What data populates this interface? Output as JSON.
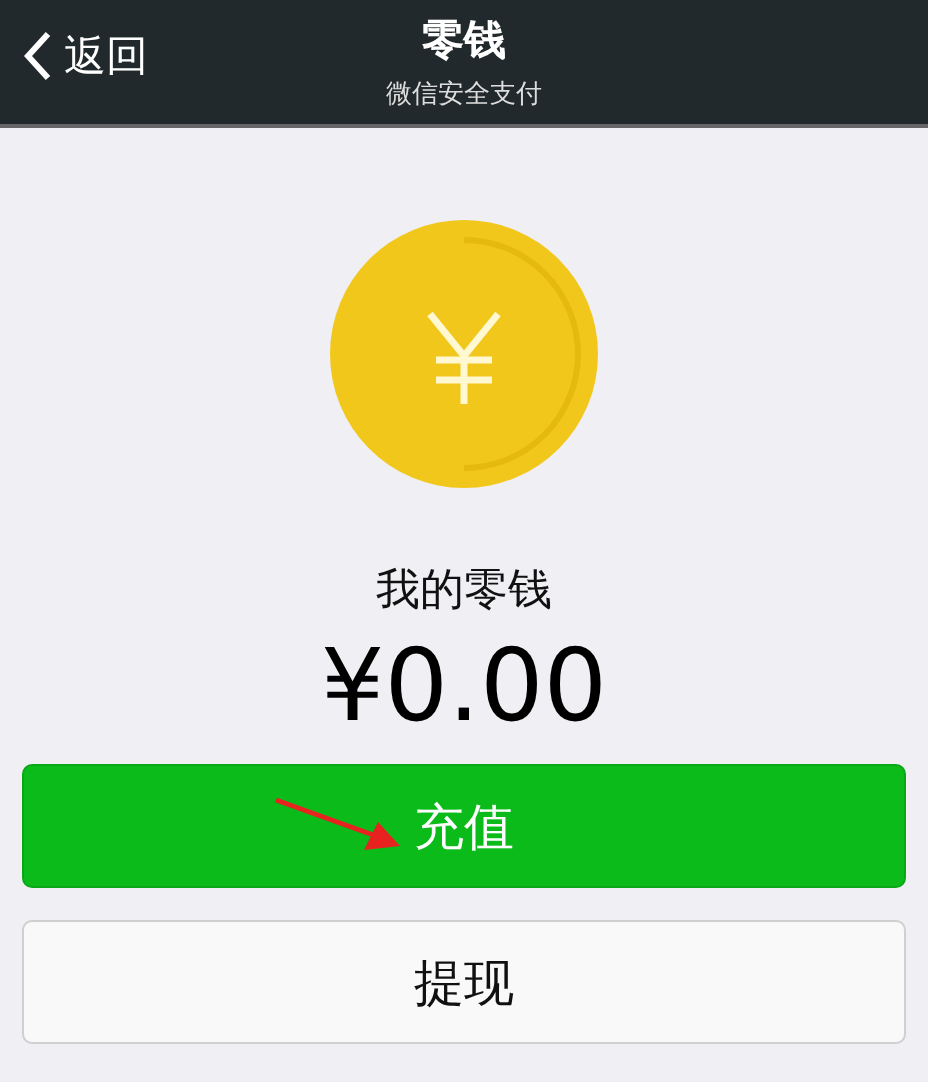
{
  "nav_bar": {
    "back_label": "返回",
    "title": "零钱",
    "subtitle": "微信安全支付"
  },
  "balance": {
    "label": "我的零钱",
    "amount": "¥0.00"
  },
  "buttons": [
    {
      "label": "充值",
      "kind": "primary"
    },
    {
      "label": "提现",
      "kind": "secondary"
    }
  ]
}
